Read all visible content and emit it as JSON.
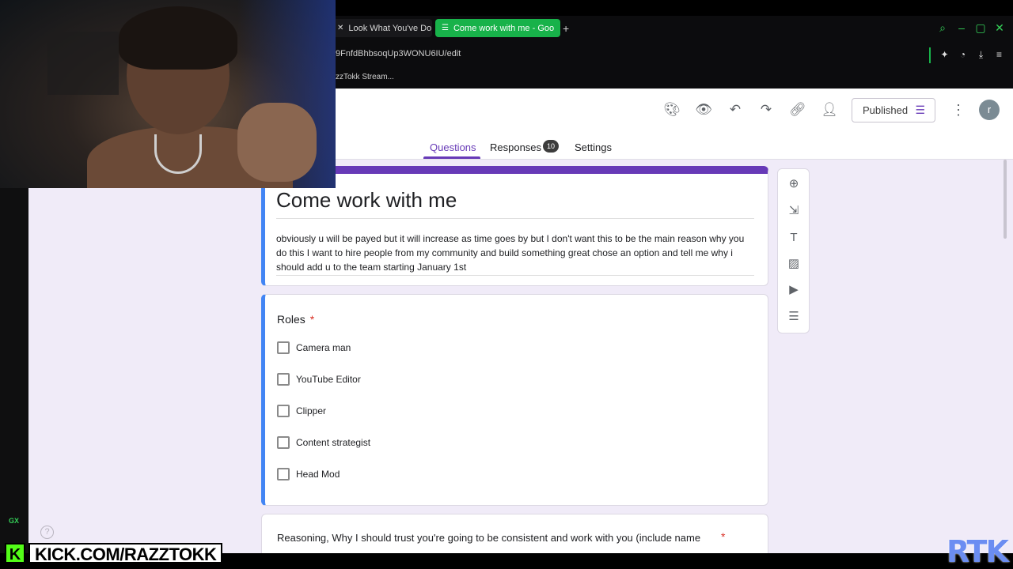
{
  "browser": {
    "tabs": [
      {
        "label": "Look What You've Do",
        "active": false
      },
      {
        "label": "Come work with me - Goo",
        "active": true
      }
    ],
    "new_tab": "+",
    "url": "9FnfdBhbsoqUp3WONU6IU/edit",
    "bookmark": "zzTokk Stream...",
    "accent_color": "#18b24a"
  },
  "forms": {
    "publish_label": "Published",
    "avatar_letter": "r",
    "tabs": {
      "questions": "Questions",
      "responses": "Responses",
      "responses_count": "10",
      "settings": "Settings"
    },
    "title": "Come work with me",
    "description": "obviously u will be payed but it will increase as time goes by but I don't want this to be the main reason why you do this I want to hire people from my community and build something great chose an option and tell me why i should add u to the team starting January 1st",
    "question1": {
      "title": "Roles",
      "required_mark": "*",
      "options": [
        "Camera man",
        "YouTube Editor",
        "Clipper",
        "Content strategist",
        "Head Mod"
      ]
    },
    "question2": {
      "title": "Reasoning, Why I should trust you're going to be consistent and work with you (include name",
      "required_mark": "*"
    },
    "theme_color": "#673ab7"
  },
  "overlay": {
    "kick_url": "KICK.COM/RAZZTOKK",
    "kick_logo": "K",
    "brand": "RTK",
    "gx_label": "GX"
  }
}
